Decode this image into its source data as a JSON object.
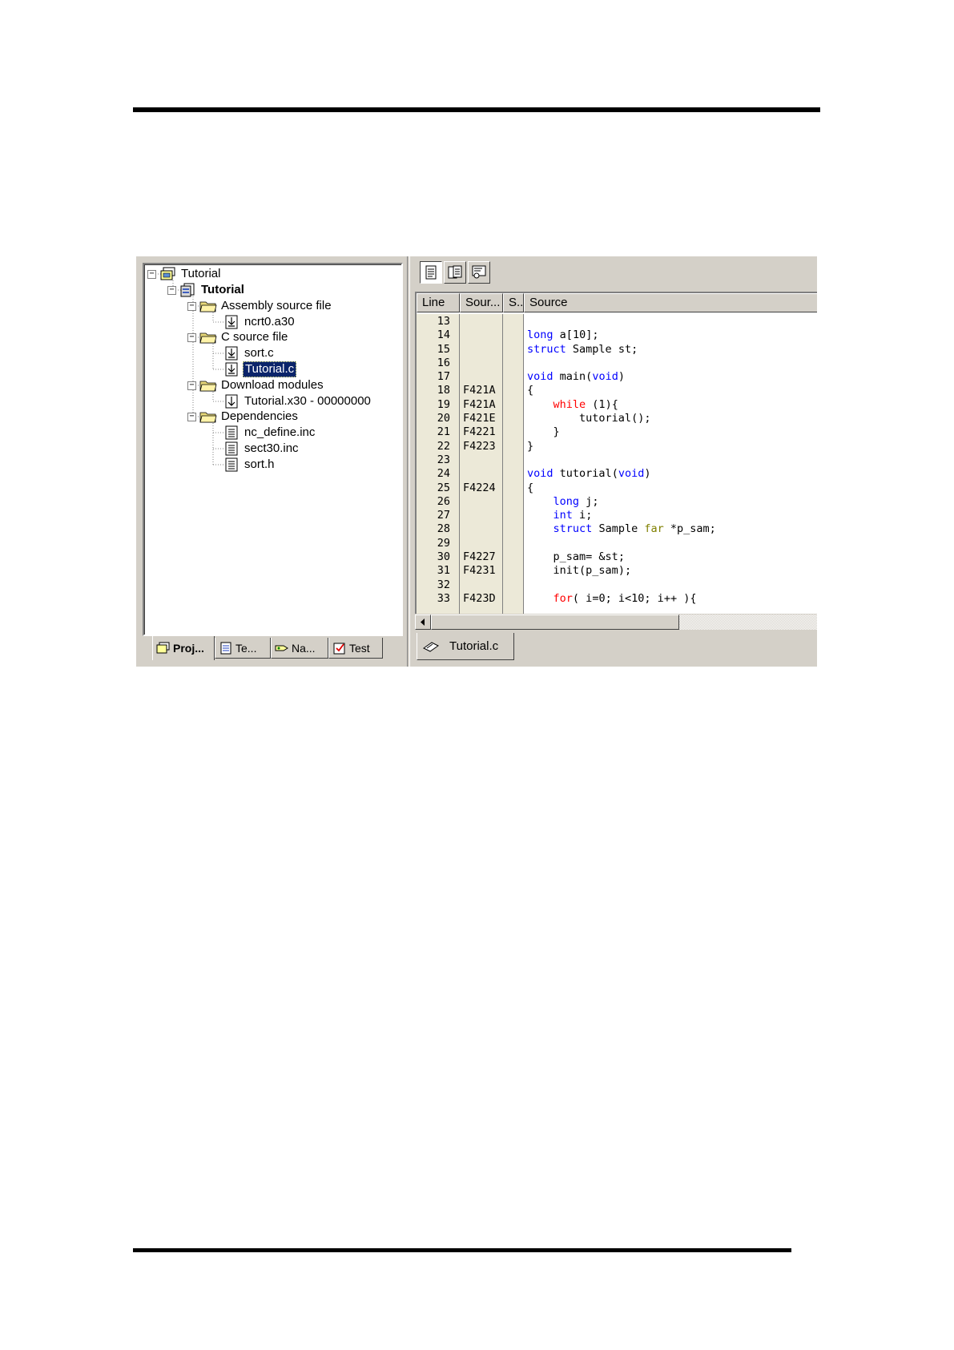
{
  "project_tree": {
    "workspace": "Tutorial",
    "project": "Tutorial",
    "folders": [
      {
        "label": "Assembly source file",
        "files": [
          "ncrt0.a30"
        ]
      },
      {
        "label": "C source file",
        "files": [
          "sort.c",
          "Tutorial.c"
        ]
      },
      {
        "label": "Download modules",
        "files": [
          "Tutorial.x30 - 00000000"
        ]
      },
      {
        "label": "Dependencies",
        "files": [
          "nc_define.inc",
          "sect30.inc",
          "sort.h"
        ]
      }
    ],
    "selected_file": "Tutorial.c",
    "expander_symbol": "−"
  },
  "workspace_tabs": [
    "Proj...",
    "Te...",
    "Na...",
    "Test"
  ],
  "editor": {
    "columns": [
      "Line",
      "Sour...",
      "S...",
      "Source"
    ],
    "rows": [
      {
        "line": "13",
        "addr": "",
        "code": ""
      },
      {
        "line": "14",
        "addr": "",
        "code": "long a[10];"
      },
      {
        "line": "15",
        "addr": "",
        "code": "struct Sample st;"
      },
      {
        "line": "16",
        "addr": "",
        "code": ""
      },
      {
        "line": "17",
        "addr": "",
        "code": "void main(void)"
      },
      {
        "line": "18",
        "addr": "F421A",
        "code": "{"
      },
      {
        "line": "19",
        "addr": "F421A",
        "code": "    while (1){"
      },
      {
        "line": "20",
        "addr": "F421E",
        "code": "        tutorial();"
      },
      {
        "line": "21",
        "addr": "F4221",
        "code": "    }"
      },
      {
        "line": "22",
        "addr": "F4223",
        "code": "}"
      },
      {
        "line": "23",
        "addr": "",
        "code": ""
      },
      {
        "line": "24",
        "addr": "",
        "code": "void tutorial(void)"
      },
      {
        "line": "25",
        "addr": "F4224",
        "code": "{"
      },
      {
        "line": "26",
        "addr": "",
        "code": "    long j;"
      },
      {
        "line": "27",
        "addr": "",
        "code": "    int i;"
      },
      {
        "line": "28",
        "addr": "",
        "code": "    struct Sample far *p_sam;"
      },
      {
        "line": "29",
        "addr": "",
        "code": ""
      },
      {
        "line": "30",
        "addr": "F4227",
        "code": "    p_sam= &st;"
      },
      {
        "line": "31",
        "addr": "F4231",
        "code": "    init(p_sam);"
      },
      {
        "line": "32",
        "addr": "",
        "code": ""
      },
      {
        "line": "33",
        "addr": "F423D",
        "code": "    for( i=0; i<10; i++ ){"
      }
    ],
    "keywords_blue": [
      "long",
      "struct",
      "void",
      "int"
    ],
    "keywords_red": [
      "while",
      "for"
    ],
    "keywords_olive": [
      "far"
    ]
  },
  "document_tabs": [
    "Tutorial.c"
  ],
  "colors": {
    "keyword": "#0000ff",
    "control": "#ff0000",
    "modifier": "#808000",
    "selection": "#0a246a",
    "chrome": "#d4d0c8"
  }
}
